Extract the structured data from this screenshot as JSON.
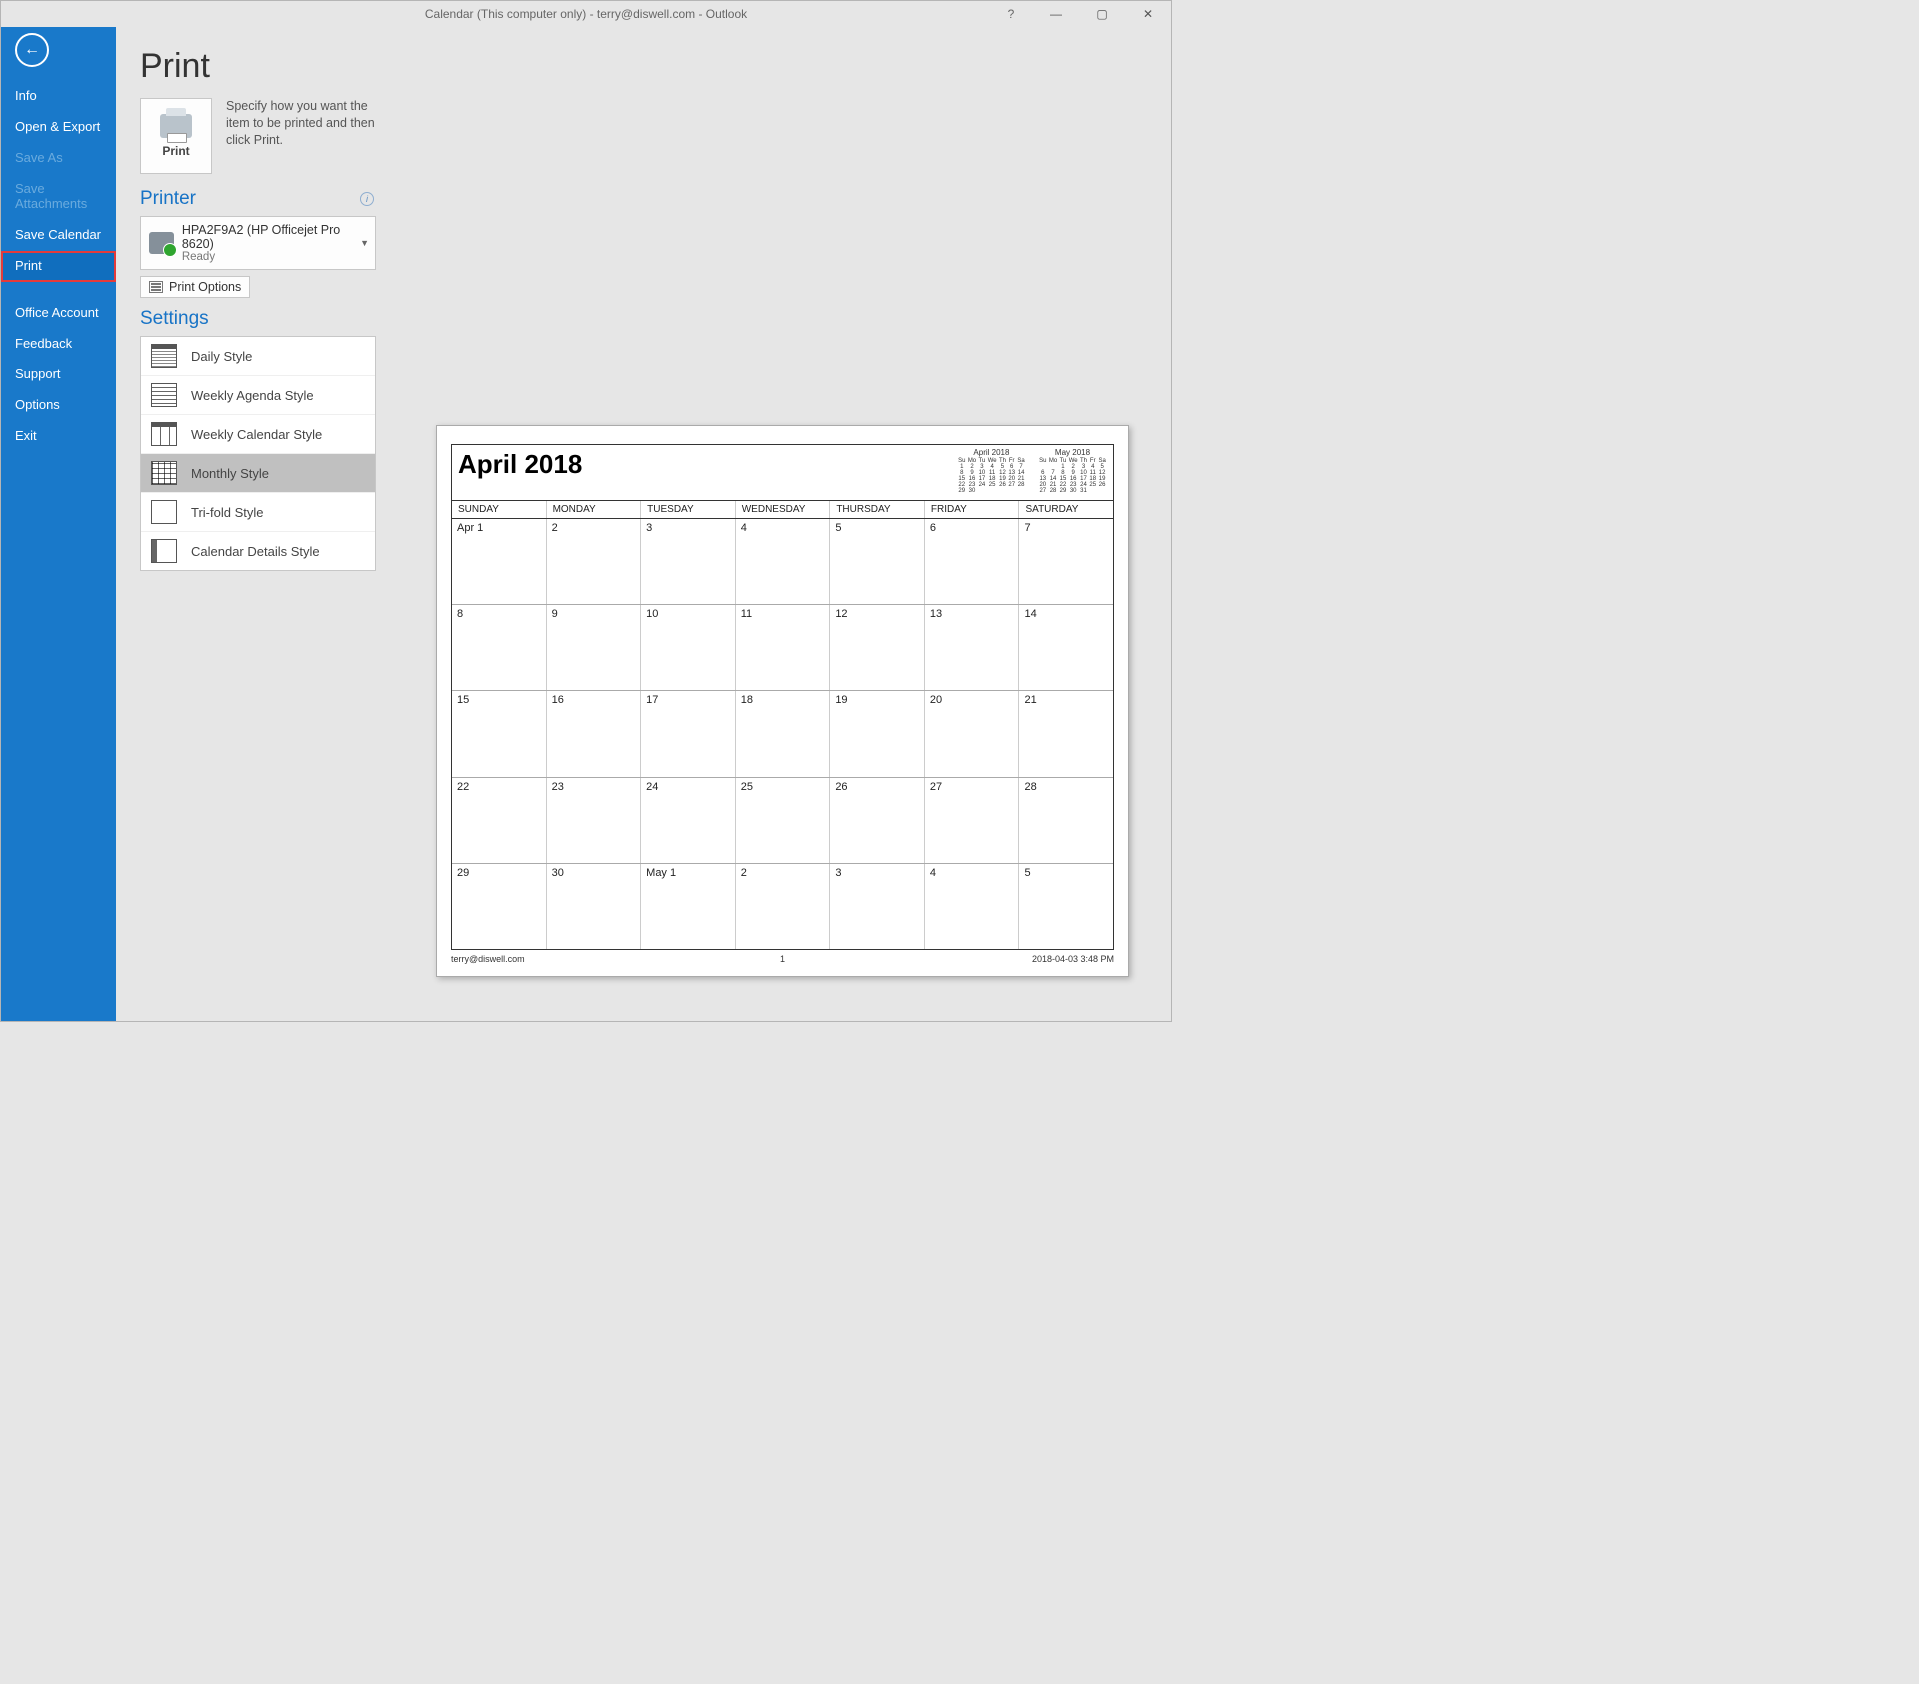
{
  "titlebar": {
    "title": "Calendar (This computer only) - terry@diswell.com  -  Outlook",
    "help": "?",
    "minimize": "—",
    "maximize": "▢",
    "close": "✕"
  },
  "sidebar": {
    "back_arrow": "←",
    "items": [
      {
        "label": "Info",
        "kind": "normal"
      },
      {
        "label": "Open & Export",
        "kind": "normal"
      },
      {
        "label": "Save As",
        "kind": "disabled"
      },
      {
        "label": "Save Attachments",
        "kind": "disabled"
      },
      {
        "label": "Save Calendar",
        "kind": "normal"
      },
      {
        "label": "Print",
        "kind": "highlight"
      },
      {
        "label": "Office Account",
        "kind": "normal",
        "spacer_before": true
      },
      {
        "label": "Feedback",
        "kind": "normal"
      },
      {
        "label": "Support",
        "kind": "normal"
      },
      {
        "label": "Options",
        "kind": "normal"
      },
      {
        "label": "Exit",
        "kind": "normal"
      }
    ]
  },
  "content": {
    "heading": "Print",
    "print_tile_label": "Print",
    "description": "Specify how you want the item to be printed and then click Print.",
    "printer_heading": "Printer",
    "printer": {
      "name": "HPA2F9A2 (HP Officejet Pro 8620)",
      "status": "Ready"
    },
    "print_options_label": "Print Options",
    "settings_heading": "Settings",
    "styles": [
      {
        "label": "Daily Style",
        "icon": "daily"
      },
      {
        "label": "Weekly Agenda Style",
        "icon": "weekly-agenda"
      },
      {
        "label": "Weekly Calendar Style",
        "icon": "weekly-cal"
      },
      {
        "label": "Monthly Style",
        "icon": "monthly",
        "selected": true
      },
      {
        "label": "Tri-fold Style",
        "icon": "trifold"
      },
      {
        "label": "Calendar Details Style",
        "icon": "details"
      }
    ]
  },
  "preview": {
    "title": "April 2018",
    "dow_short": [
      "Su",
      "Mo",
      "Tu",
      "We",
      "Th",
      "Fr",
      "Sa"
    ],
    "mini_calendars": [
      {
        "title": "April 2018",
        "rows": [
          [
            "1",
            "2",
            "3",
            "4",
            "5",
            "6",
            "7"
          ],
          [
            "8",
            "9",
            "10",
            "11",
            "12",
            "13",
            "14"
          ],
          [
            "15",
            "16",
            "17",
            "18",
            "19",
            "20",
            "21"
          ],
          [
            "22",
            "23",
            "24",
            "25",
            "26",
            "27",
            "28"
          ],
          [
            "29",
            "30",
            "",
            "",
            "",
            "",
            ""
          ]
        ]
      },
      {
        "title": "May 2018",
        "rows": [
          [
            "",
            "",
            "1",
            "2",
            "3",
            "4",
            "5"
          ],
          [
            "6",
            "7",
            "8",
            "9",
            "10",
            "11",
            "12"
          ],
          [
            "13",
            "14",
            "15",
            "16",
            "17",
            "18",
            "19"
          ],
          [
            "20",
            "21",
            "22",
            "23",
            "24",
            "25",
            "26"
          ],
          [
            "27",
            "28",
            "29",
            "30",
            "31",
            "",
            ""
          ]
        ]
      }
    ],
    "dow": [
      "SUNDAY",
      "MONDAY",
      "TUESDAY",
      "WEDNESDAY",
      "THURSDAY",
      "FRIDAY",
      "SATURDAY"
    ],
    "weeks": [
      [
        "Apr 1",
        "2",
        "3",
        "4",
        "5",
        "6",
        "7"
      ],
      [
        "8",
        "9",
        "10",
        "11",
        "12",
        "13",
        "14"
      ],
      [
        "15",
        "16",
        "17",
        "18",
        "19",
        "20",
        "21"
      ],
      [
        "22",
        "23",
        "24",
        "25",
        "26",
        "27",
        "28"
      ],
      [
        "29",
        "30",
        "May 1",
        "2",
        "3",
        "4",
        "5"
      ]
    ],
    "footer_left": "terry@diswell.com",
    "footer_mid": "1",
    "footer_right": "2018-04-03 3:48 PM"
  }
}
